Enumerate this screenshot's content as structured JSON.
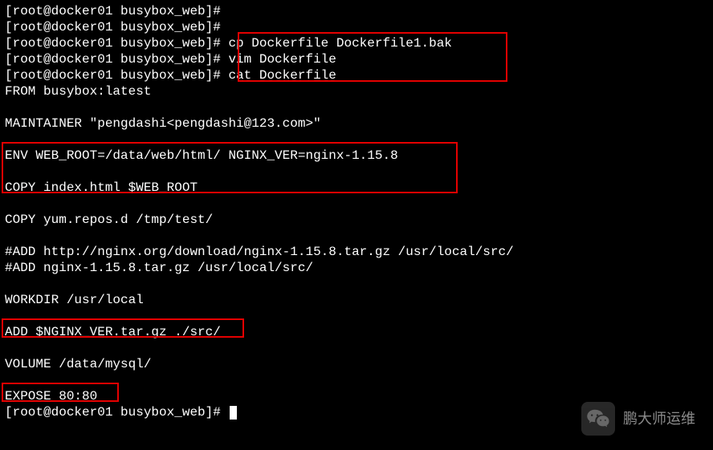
{
  "prompt": {
    "user": "root",
    "host": "docker01",
    "cwd": "busybox_web",
    "symbol": "#"
  },
  "lines": {
    "l0": "[root@docker01 busybox_web]#",
    "l1": "[root@docker01 busybox_web]#",
    "l2": "[root@docker01 busybox_web]# cp Dockerfile Dockerfile1.bak",
    "l3": "[root@docker01 busybox_web]# vim Dockerfile",
    "l4": "[root@docker01 busybox_web]# cat Dockerfile",
    "l5": "FROM busybox:latest",
    "l6": "",
    "l7": "MAINTAINER \"pengdashi<pengdashi@123.com>\"",
    "l8": "",
    "l9": "ENV WEB_ROOT=/data/web/html/ NGINX_VER=nginx-1.15.8",
    "l10": "",
    "l11": "COPY index.html $WEB_ROOT",
    "l12": "",
    "l13": "COPY yum.repos.d /tmp/test/",
    "l14": "",
    "l15": "#ADD http://nginx.org/download/nginx-1.15.8.tar.gz /usr/local/src/",
    "l16": "#ADD nginx-1.15.8.tar.gz /usr/local/src/",
    "l17": "",
    "l18": "WORKDIR /usr/local",
    "l19": "",
    "l20": "ADD $NGINX_VER.tar.gz ./src/",
    "l21": "",
    "l22": "VOLUME /data/mysql/",
    "l23": "",
    "l24": "EXPOSE 80:80",
    "l25": "[root@docker01 busybox_web]# "
  },
  "watermark": {
    "text": "鹏大师运维"
  }
}
